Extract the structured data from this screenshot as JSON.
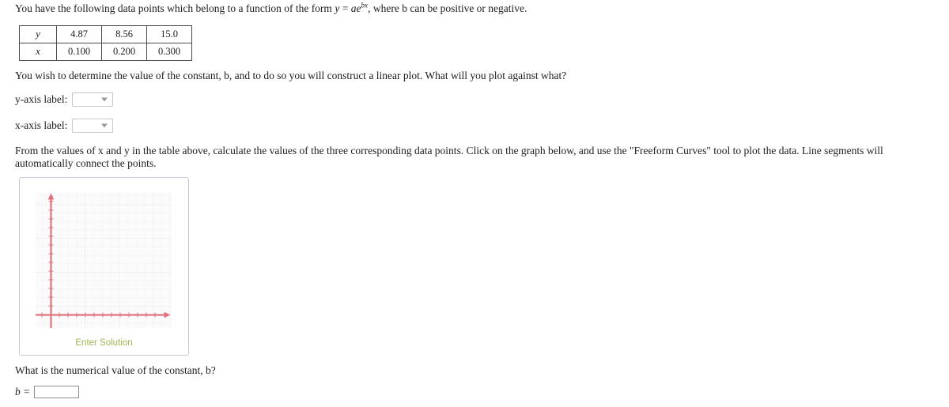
{
  "intro": {
    "before_formula": "You have the following data points which belong to a function of the form ",
    "formula": {
      "y": "y",
      "equals": "=",
      "a": "a",
      "e": "e",
      "exponent": "bx"
    },
    "after_formula": ", where b can be positive or negative."
  },
  "table": {
    "rows": [
      {
        "header": "y",
        "values": [
          "4.87",
          "8.56",
          "15.0"
        ]
      },
      {
        "header": "x",
        "values": [
          "0.100",
          "0.200",
          "0.300"
        ]
      }
    ]
  },
  "plot_question": "You wish to determine the value of the constant, b, and to do so you will construct a linear plot. What will you plot against what?",
  "axis_selects": [
    {
      "caption": "y-axis label:",
      "value": "",
      "icon": "chevron-down-icon"
    },
    {
      "caption": "x-axis label:",
      "value": "",
      "icon": "chevron-down-icon"
    }
  ],
  "instructions": "From the values of x and y in the table above, calculate the values of the three corresponding data points. Click on the graph below, and use the \"Freeform Curves\" tool to plot the data. Line segments will automatically connect the points.",
  "graph": {
    "enter_solution_label": "Enter Solution",
    "axis_color": "#e0737c",
    "grid_color": "#f0f0f2",
    "panel_border_color": "#c4c9d2",
    "enter_solution_color": "#9eb750",
    "plotted_points": []
  },
  "final_question": "What is the numerical value of the constant, b?",
  "answer": {
    "label": "b =",
    "value": "",
    "placeholder": ""
  },
  "chart_data": {
    "type": "scatter",
    "title": "",
    "xlabel": "",
    "ylabel": "",
    "x": [
      0.1,
      0.2,
      0.3
    ],
    "y": [
      4.87,
      8.56,
      15.0
    ],
    "series": [
      {
        "name": "data points",
        "x": [
          0.1,
          0.2,
          0.3
        ],
        "y": [
          4.87,
          8.56,
          15.0
        ]
      }
    ],
    "plotted_series": [],
    "grid": true,
    "legend": "none",
    "xlim": [
      0,
      1
    ],
    "ylim": [
      0,
      1
    ],
    "axis_ticks_labeled": false,
    "note": "Empty answer grid: axes drawn with arrowheads and unlabeled tick marks; no data plotted yet."
  }
}
